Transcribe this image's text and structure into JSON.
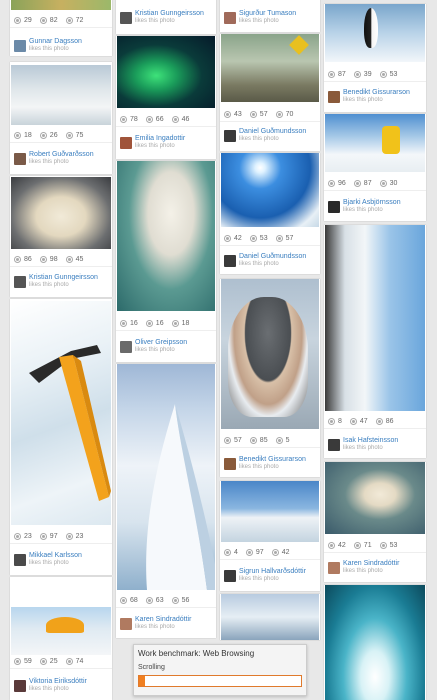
{
  "likes_text": "likes this photo",
  "cards": [
    {
      "id": "c1",
      "stats": [
        "29",
        "82",
        "72"
      ],
      "user": "Gunnar Dagsson"
    },
    {
      "id": "c2",
      "user": "Kristian Gunngeirsson"
    },
    {
      "id": "c3",
      "user": "Sigurður Tumason"
    },
    {
      "id": "c4",
      "stats": [
        "87",
        "39",
        "53"
      ],
      "user": "Benedikt Gissurarson"
    },
    {
      "id": "c5",
      "stats": [
        "78",
        "66",
        "46"
      ],
      "user": "Emilia Ingadottir"
    },
    {
      "id": "c6",
      "stats": [
        "43",
        "57",
        "70"
      ],
      "user": "Daniel Guðmundsson"
    },
    {
      "id": "c7",
      "stats": [
        "18",
        "26",
        "75"
      ],
      "user": "Robert Guðvarðsson"
    },
    {
      "id": "c8",
      "stats": [
        "96",
        "87",
        "30"
      ],
      "user": "Bjarki Asbjörnsson"
    },
    {
      "id": "c9",
      "stats": [
        "86",
        "98",
        "45"
      ],
      "user": "Kristian Gunngeirsson"
    },
    {
      "id": "c10",
      "stats": [
        "42",
        "53",
        "57"
      ],
      "user": "Daniel Guðmundsson"
    },
    {
      "id": "c11",
      "stats": [
        "16",
        "16",
        "18"
      ],
      "user": "Oliver Greipsson"
    },
    {
      "id": "c12",
      "stats": [
        "8",
        "47",
        "86"
      ],
      "user": "Isak Hafsteinsson"
    },
    {
      "id": "c13",
      "stats": [
        "57",
        "85",
        "5"
      ],
      "user": "Benedikt Gissurarson"
    },
    {
      "id": "c14",
      "stats": [
        "23",
        "97",
        "23"
      ],
      "user": "Mikkael Karlsson"
    },
    {
      "id": "c15",
      "stats": [
        "42",
        "71",
        "53"
      ],
      "user": "Karen Sindradóttir"
    },
    {
      "id": "c16",
      "stats": [
        "4",
        "97",
        "42"
      ],
      "user": "Sigrun Hallvarðsdóttir"
    },
    {
      "id": "c17",
      "stats": [
        "68",
        "63",
        "56"
      ],
      "user": "Karen Sindradóttir"
    },
    {
      "id": "c18",
      "stats": [
        "59",
        "25",
        "74"
      ],
      "user": "Viktoria Eiriksdóttir"
    }
  ],
  "benchmark": {
    "title": "Work benchmark: Web Browsing",
    "status": "Scrolling",
    "progress": 0.04,
    "accent": "#f07f21"
  }
}
